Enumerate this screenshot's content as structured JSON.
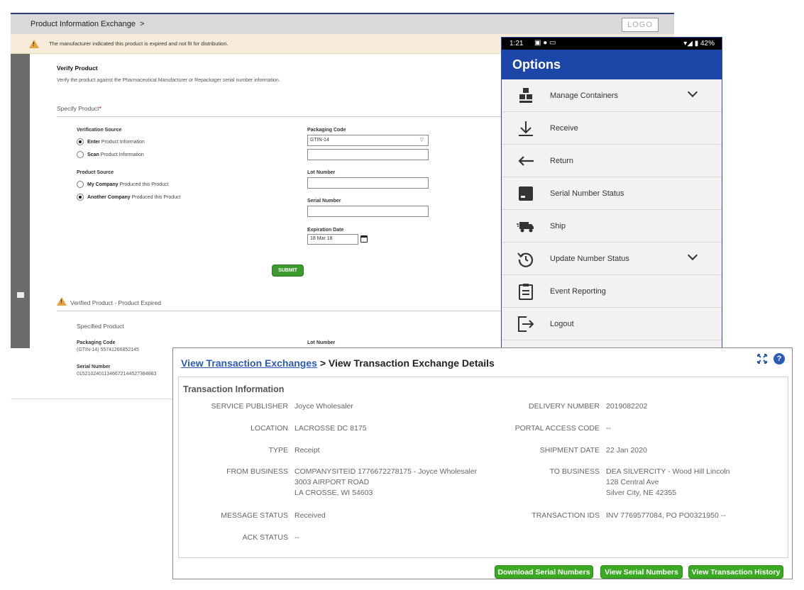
{
  "web_app": {
    "breadcrumb": "Product Information Exchange",
    "breadcrumb_arrow": ">",
    "logo": "LOGO",
    "warning": "The manufacturer indicated this product is expired and not fit for distribution.",
    "verify_title": "Verify Product",
    "verify_subtitle": "Verify the product against the Pharmaceutical Manufacturer or Repackager serial number information.",
    "specify_product": "Specify Product",
    "required_mark": "*",
    "verification_source_label": "Verification Source",
    "verification_options": [
      {
        "bold": "Enter",
        "rest": " Product Information",
        "selected": true
      },
      {
        "bold": "Scan",
        "rest": " Product Information",
        "selected": false
      }
    ],
    "product_source_label": "Product Source",
    "product_source_options": [
      {
        "bold": "My Company",
        "rest": " Produced this Product",
        "selected": false
      },
      {
        "bold": "Another Company",
        "rest": " Produced this Product",
        "selected": true
      }
    ],
    "packaging_code_label": "Packaging Code",
    "packaging_code_value": "GTIN-14",
    "lot_number_label": "Lot Number",
    "serial_number_label": "Serial Number",
    "expiration_date_label": "Expiration Date",
    "expiration_date_value": "18 Mar 18",
    "submit_label": "SUBMIT",
    "verified_title": "Verified Product - Product Expired",
    "specified_product": "Specified Product",
    "result_packaging_label": "Packaging Code",
    "result_packaging_value": "(GTIN-14) 55741266852145",
    "result_lot_label": "Lot Number",
    "result_serial_label": "Serial Number",
    "result_serial_value": "01521024011346672144527384883"
  },
  "mobile": {
    "time": "1:21",
    "battery": "42%",
    "title": "Options",
    "items": [
      {
        "label": "Manage Containers",
        "icon": "boxes-icon",
        "has_chevron": true
      },
      {
        "label": "Receive",
        "icon": "download-arrow-icon",
        "has_chevron": false
      },
      {
        "label": "Return",
        "icon": "return-arrow-icon",
        "has_chevron": false
      },
      {
        "label": "Serial Number Status",
        "icon": "container-icon",
        "has_chevron": false
      },
      {
        "label": "Ship",
        "icon": "truck-icon",
        "has_chevron": false
      },
      {
        "label": "Update Number Status",
        "icon": "history-icon",
        "has_chevron": true
      },
      {
        "label": "Event Reporting",
        "icon": "clipboard-icon",
        "has_chevron": false
      },
      {
        "label": "Logout",
        "icon": "logout-icon",
        "has_chevron": false
      }
    ]
  },
  "dialog": {
    "breadcrumb_link": "View Transaction Exchanges",
    "breadcrumb_rest": " > View Transaction Exchange Details",
    "section_title": "Transaction Information",
    "left_fields": [
      {
        "key": "SERVICE PUBLISHER",
        "lines": [
          "Joyce Wholesaler"
        ]
      },
      {
        "key": "LOCATION",
        "lines": [
          "LACROSSE DC 8175"
        ]
      },
      {
        "key": "TYPE",
        "lines": [
          "Receipt"
        ]
      },
      {
        "key": "FROM BUSINESS",
        "lines": [
          "COMPANYSITEID 1776672278175 - Joyce Wholesaler",
          "3003 AIRPORT ROAD",
          "LA CROSSE, WI 54603"
        ]
      },
      {
        "key": "MESSAGE STATUS",
        "lines": [
          "Received"
        ]
      },
      {
        "key": "ACK STATUS",
        "lines": [
          "--"
        ]
      }
    ],
    "right_fields": [
      {
        "key": "DELIVERY NUMBER",
        "lines": [
          "2019082202"
        ]
      },
      {
        "key": "PORTAL ACCESS CODE",
        "lines": [
          "--"
        ]
      },
      {
        "key": "SHIPMENT DATE",
        "lines": [
          "22 Jan 2020"
        ]
      },
      {
        "key": "TO BUSINESS",
        "lines": [
          "DEA SILVERCITY - Wood Hill Lincoln",
          "128 Central Ave",
          "Silver City, NE 42355"
        ]
      },
      {
        "key": "TRANSACTION IDS",
        "lines": [
          "INV 7769577084, PO PO0321950 --"
        ]
      }
    ],
    "buttons": [
      "Download Serial Numbers",
      "View Serial Numbers",
      "View Transaction History"
    ]
  },
  "colors": {
    "brand_blue": "#1c47a8",
    "link_blue": "#2a5bb5",
    "action_green": "#3aaa23",
    "warning_orange": "#e6a23c"
  }
}
